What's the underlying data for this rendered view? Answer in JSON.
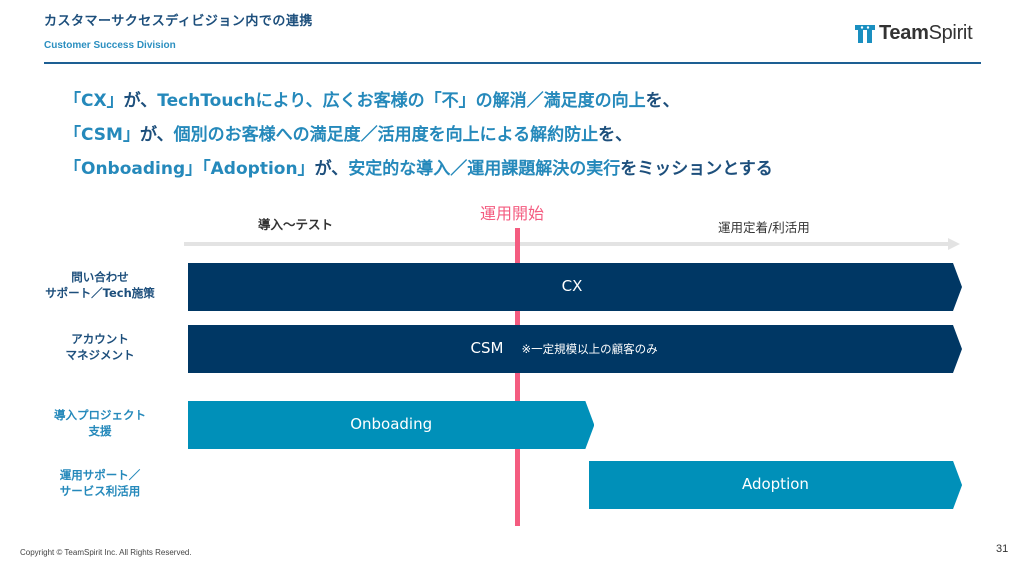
{
  "header": {
    "title": "カスタマーサクセスディビジョン内での連携",
    "subtitle": "Customer Success Division",
    "logo_text_bold": "Team",
    "logo_text_light": "Spirit"
  },
  "mission": {
    "lines": [
      [
        {
          "text": "「CX」",
          "tone": "light"
        },
        {
          "text": "が、",
          "tone": "dark"
        },
        {
          "text": "TechTouchにより、広くお客様の「不」の解消／満足度の向上",
          "tone": "light"
        },
        {
          "text": "を、",
          "tone": "dark"
        }
      ],
      [
        {
          "text": "「CSM」",
          "tone": "light"
        },
        {
          "text": "が、",
          "tone": "dark"
        },
        {
          "text": "個別のお客様への満足度／活用度を向上による解約防止",
          "tone": "light"
        },
        {
          "text": "を、",
          "tone": "dark"
        }
      ],
      [
        {
          "text": "「Onboading」「Adoption」",
          "tone": "light"
        },
        {
          "text": "が、",
          "tone": "dark"
        },
        {
          "text": "安定的な導入／運用課題解決の実行",
          "tone": "light"
        },
        {
          "text": "をミッションとする",
          "tone": "dark"
        }
      ]
    ]
  },
  "timeline": {
    "phase_left": "導入～テスト",
    "phase_right": "運用定着/利活用",
    "milestone": "運用開始",
    "colors": {
      "dark_bar": "#003764",
      "light_bar": "#0090b9",
      "milestone": "#f45c80",
      "axis": "#e3e3e3"
    },
    "rows": [
      {
        "label": "問い合わせ\nサポート／Tech施策",
        "tone": "dark",
        "bar_label": "CX",
        "note": "",
        "start": 0,
        "end": 1,
        "color": "dark"
      },
      {
        "label": "アカウント\nマネジメント",
        "tone": "dark",
        "bar_label": "CSM",
        "note": "※一定規模以上の顧客のみ",
        "start": 0,
        "end": 1,
        "color": "dark"
      },
      {
        "label": "導入プロジェクト\n支援",
        "tone": "light",
        "bar_label": "Onboading",
        "note": "",
        "start": 0,
        "end": 0.525,
        "color": "light"
      },
      {
        "label": "運用サポート／\nサービス利活用",
        "tone": "light",
        "bar_label": "Adoption",
        "note": "",
        "start": 0.518,
        "end": 1,
        "color": "light"
      }
    ]
  },
  "footer": {
    "copyright": "Copyright © TeamSpirit Inc. All Rights Reserved.",
    "page_number": "31"
  }
}
